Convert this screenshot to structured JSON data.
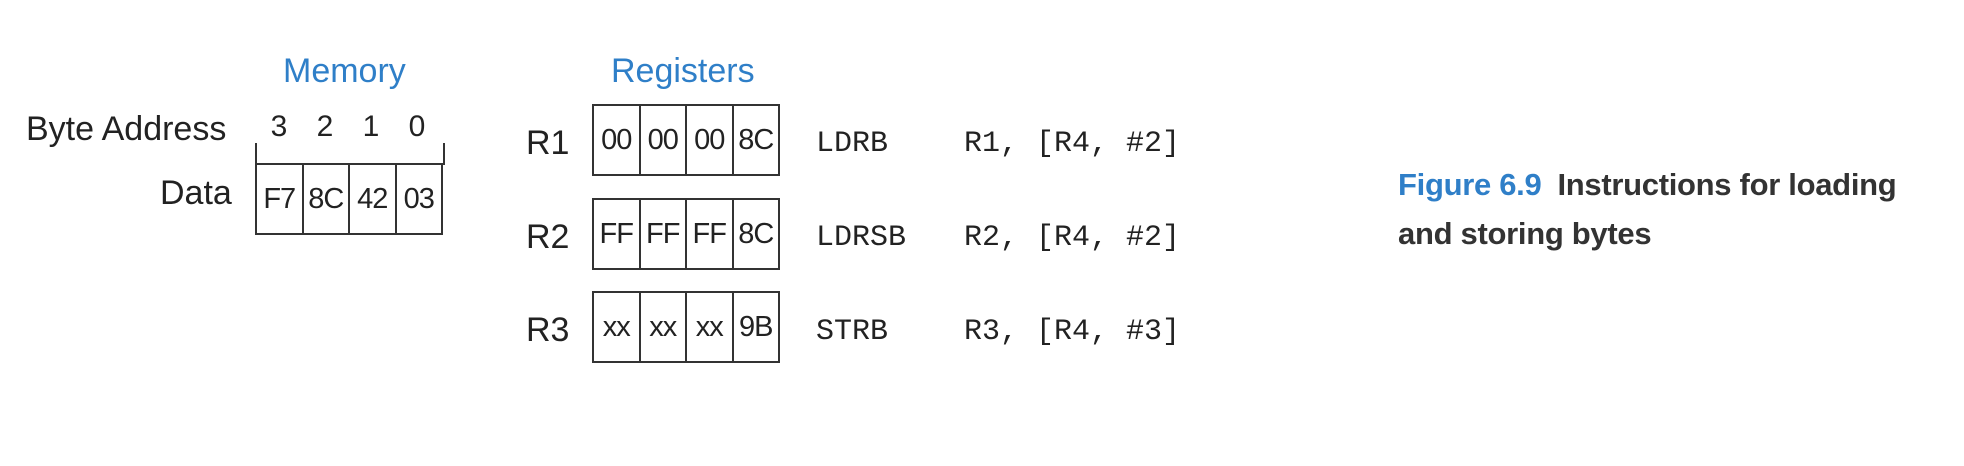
{
  "memory": {
    "title": "Memory",
    "address_label": "Byte Address",
    "data_label": "Data",
    "addresses": [
      "3",
      "2",
      "1",
      "0"
    ],
    "bytes": [
      "F7",
      "8C",
      "42",
      "03"
    ]
  },
  "registers": {
    "title": "Registers",
    "rows": [
      {
        "name": "R1",
        "bytes": [
          "00",
          "00",
          "00",
          "8C"
        ],
        "op": "LDRB",
        "operands": "R1, [R4, #2]"
      },
      {
        "name": "R2",
        "bytes": [
          "FF",
          "FF",
          "FF",
          "8C"
        ],
        "op": "LDRSB",
        "operands": "R2, [R4, #2]"
      },
      {
        "name": "R3",
        "bytes": [
          "xx",
          "xx",
          "xx",
          "9B"
        ],
        "op": "STRB",
        "operands": "R3, [R4, #3]"
      }
    ]
  },
  "caption": {
    "figure_number": "Figure 6.9",
    "line1": "Instructions for loading",
    "line2": "and storing bytes"
  },
  "colors": {
    "accent": "#2f7fc8",
    "text": "#222222",
    "stroke": "#333333"
  }
}
